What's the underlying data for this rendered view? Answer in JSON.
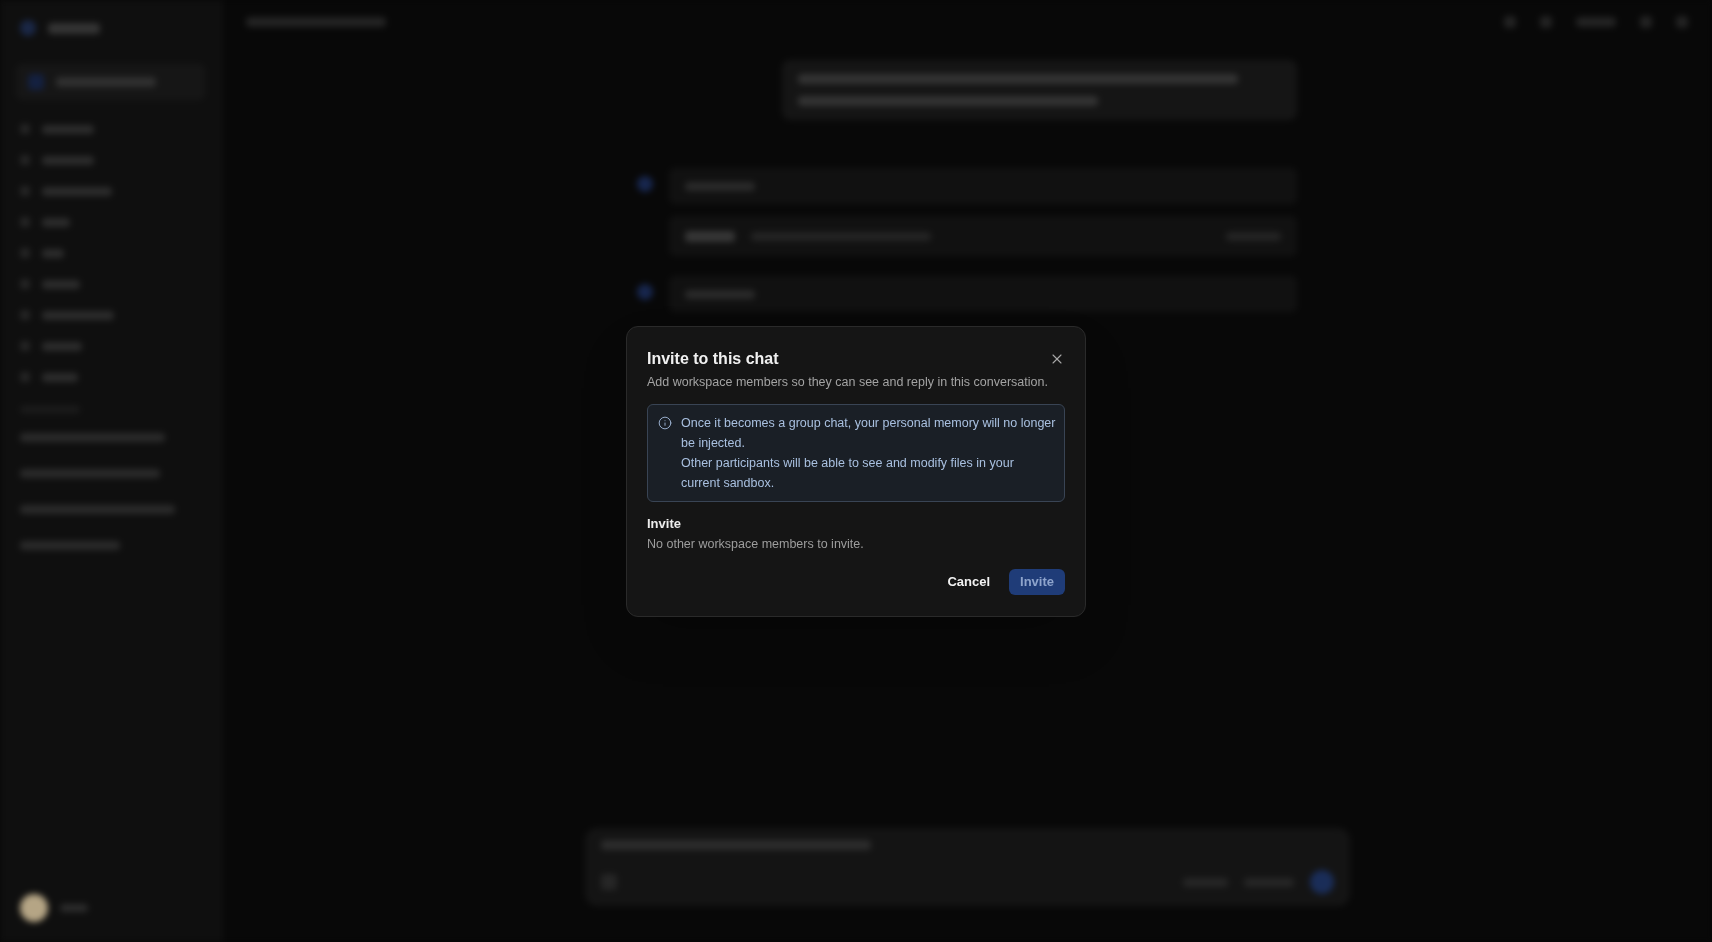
{
  "dialog": {
    "title": "Invite to this chat",
    "description": "Add workspace members so they can see and reply in this conversation.",
    "notice": {
      "lines": [
        "Once it becomes a group chat, your personal memory will no longer be injected.",
        "Other participants will be able to see and modify files in your current sandbox."
      ]
    },
    "invite_section": {
      "label": "Invite",
      "empty_message": "No other workspace members to invite."
    },
    "buttons": [
      {
        "label": "Cancel",
        "kind": "secondary",
        "disabled": false
      },
      {
        "label": "Invite",
        "kind": "primary",
        "disabled": true
      }
    ]
  }
}
